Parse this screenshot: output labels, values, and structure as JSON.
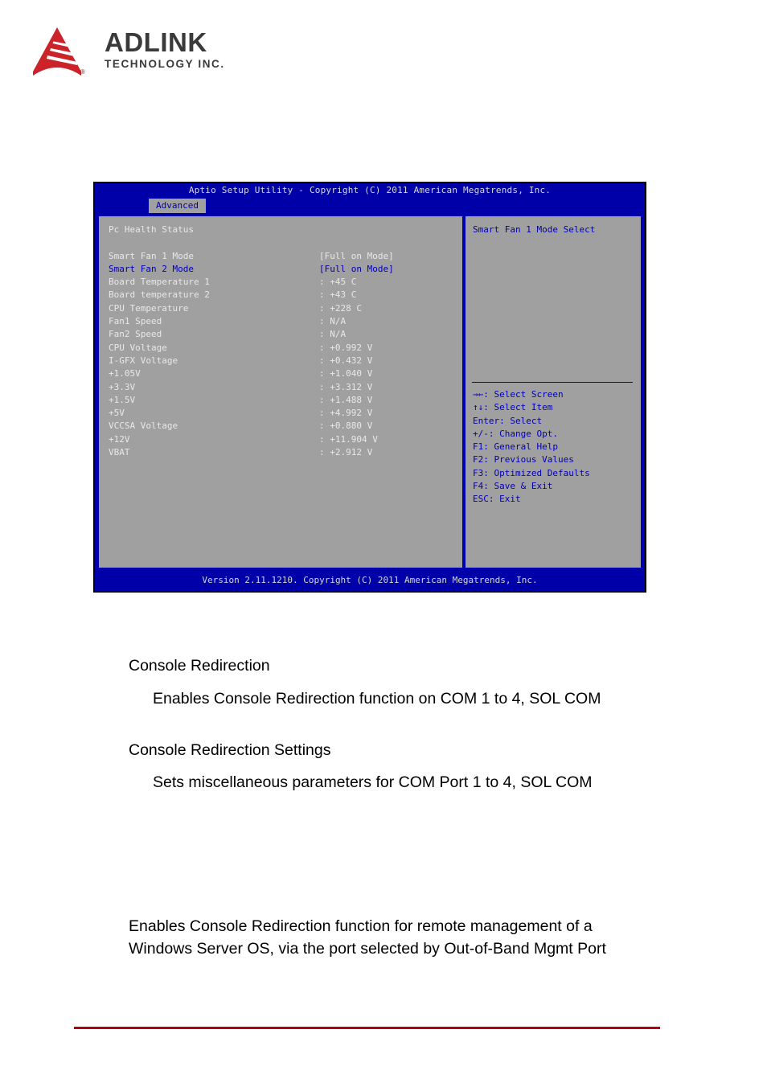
{
  "brand": {
    "name": "ADLINK",
    "tagline": "TECHNOLOGY INC.",
    "registered_mark": "®",
    "logo_color": "#cc2229"
  },
  "bios": {
    "title": "Aptio Setup Utility - Copyright (C) 2011 American Megatrends, Inc.",
    "active_tab": "Advanced",
    "section_title": "Pc Health Status",
    "footer": "Version 2.11.1210. Copyright (C) 2011 American Megatrends, Inc.",
    "colors": {
      "screen_blue": "#0000a8",
      "panel_gray": "#a0a0a0",
      "border_blue": "#0000b0",
      "text_light": "#e8e8e8",
      "text_selected": "#0000b4"
    },
    "items": [
      {
        "label": "Smart Fan 1 Mode",
        "value": "[Full on Mode]",
        "selected": false
      },
      {
        "label": "Smart Fan 2 Mode",
        "value": "[Full on Mode]",
        "selected": true
      },
      {
        "label": "Board Temperature 1",
        "value": ": +45 C",
        "selected": false
      },
      {
        "label": "Board temperature 2",
        "value": ": +43 C",
        "selected": false
      },
      {
        "label": "CPU Temperature",
        "value": ": +228 C",
        "selected": false
      },
      {
        "label": "Fan1 Speed",
        "value": ": N/A",
        "selected": false
      },
      {
        "label": "Fan2 Speed",
        "value": ": N/A",
        "selected": false
      },
      {
        "label": "CPU Voltage",
        "value": ": +0.992 V",
        "selected": false
      },
      {
        "label": "I-GFX Voltage",
        "value": ": +0.432 V",
        "selected": false
      },
      {
        "label": "+1.05V",
        "value": ": +1.040 V",
        "selected": false
      },
      {
        "label": "+3.3V",
        "value": ": +3.312 V",
        "selected": false
      },
      {
        "label": "+1.5V",
        "value": ": +1.488 V",
        "selected": false
      },
      {
        "label": "+5V",
        "value": ": +4.992 V",
        "selected": false
      },
      {
        "label": "VCCSA Voltage",
        "value": ": +0.880 V",
        "selected": false
      },
      {
        "label": "+12V",
        "value": ": +11.904 V",
        "selected": false
      },
      {
        "label": "VBAT",
        "value": ": +2.912 V",
        "selected": false
      }
    ],
    "help_text": "Smart Fan 1 Mode Select",
    "keys": [
      "→←: Select Screen",
      "↑↓: Select Item",
      "Enter: Select",
      "+/-: Change Opt.",
      "F1: General Help",
      "F2: Previous Values",
      "F3: Optimized Defaults",
      "F4: Save & Exit",
      "ESC: Exit"
    ]
  },
  "document": {
    "heading_1": "Console Redirection",
    "body_1": "Enables Console Redirection function on COM 1 to 4, SOL COM",
    "heading_2": "Console Redirection Settings",
    "body_2": "Sets miscellaneous parameters for COM Port 1 to 4, SOL COM",
    "body_3": "Enables Console Redirection function for remote management of a Windows Server OS, via the port selected by Out-of-Band Mgmt Port",
    "rule_color": "#b00014"
  }
}
